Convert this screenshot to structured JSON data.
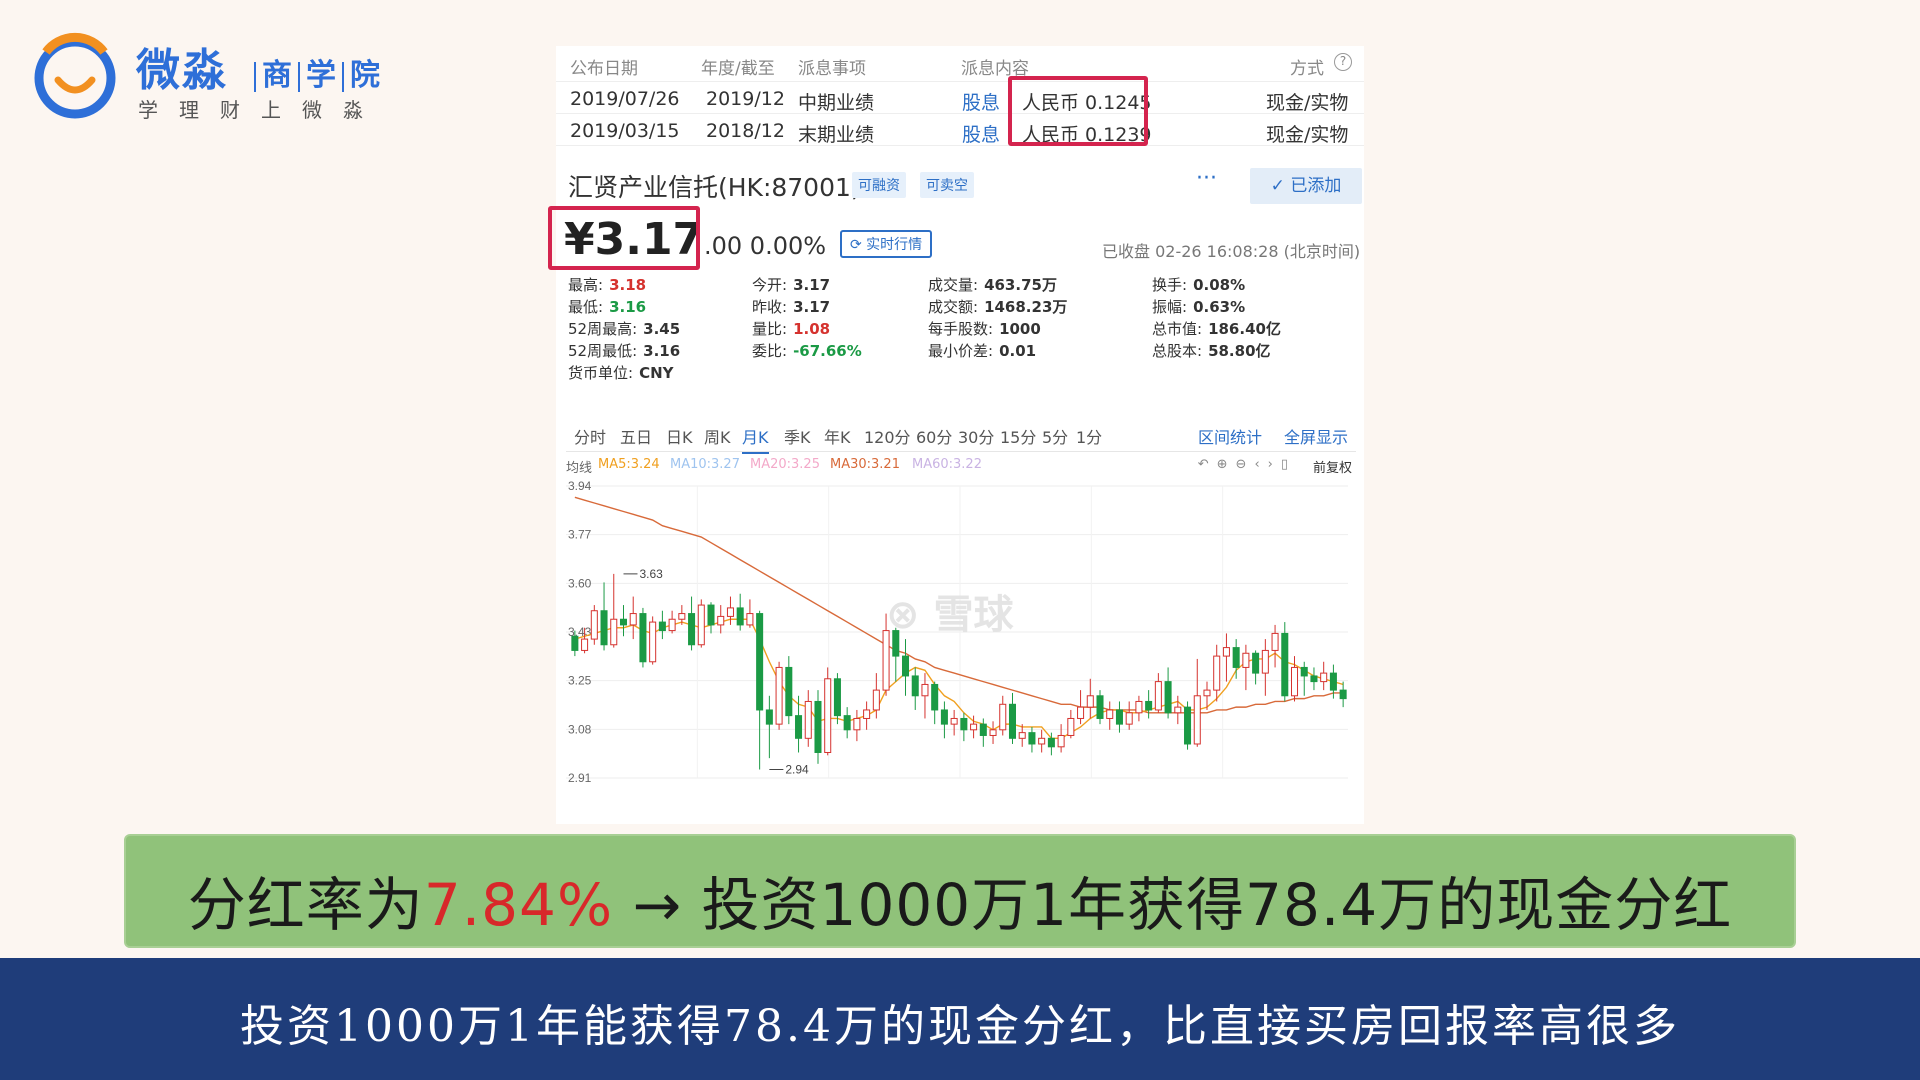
{
  "logo": {
    "title": "微淼",
    "sub1": "商",
    "sub2": "学",
    "sub3": "院",
    "slogan": "学理财上微淼",
    "icon": "smile-circle-logo"
  },
  "dividend_table": {
    "headers": [
      "公布日期",
      "年度/截至",
      "派息事项",
      "派息内容",
      "方式"
    ],
    "help_icon": "question-circle-icon",
    "rows": [
      {
        "date": "2019/07/26",
        "period": "2019/12",
        "type": "中期业绩",
        "kind": "股息",
        "content": "人民币 0.1245",
        "method": "现金/实物"
      },
      {
        "date": "2019/03/15",
        "period": "2018/12",
        "type": "末期业绩",
        "kind": "股息",
        "content": "人民币 0.1239",
        "method": "现金/实物"
      }
    ]
  },
  "stock": {
    "name": "汇贤产业信托(HK:87001)",
    "tag1": "可融资",
    "tag2": "可卖空",
    "more": "···",
    "added": "✓ 已添加",
    "price": "¥3.17",
    "change": ".00 0.00%",
    "realtime": "⟳ 实时行情",
    "closed_info": "已收盘 02-26 16:08:28 (北京时间)"
  },
  "stats": {
    "high_label": "最高:",
    "high": "3.18",
    "low_label": "最低:",
    "low": "3.16",
    "w52h_label": "52周最高:",
    "w52h": "3.45",
    "w52l_label": "52周最低:",
    "w52l": "3.16",
    "cur_label": "货币单位:",
    "cur": "CNY",
    "open_label": "今开:",
    "open": "3.17",
    "prev_label": "昨收:",
    "prev": "3.17",
    "vr_label": "量比:",
    "vr": "1.08",
    "wb_label": "委比:",
    "wb": "-67.66%",
    "vol_label": "成交量:",
    "vol": "463.75万",
    "amt_label": "成交额:",
    "amt": "1468.23万",
    "lot_label": "每手股数:",
    "lot": "1000",
    "tick_label": "最小价差:",
    "tick": "0.01",
    "turn_label": "换手:",
    "turn": "0.08%",
    "amp_label": "振幅:",
    "amp": "0.63%",
    "mcap_label": "总市值:",
    "mcap": "186.40亿",
    "shares_label": "总股本:",
    "shares": "58.80亿"
  },
  "chart_tabs": {
    "tabs": [
      "分时",
      "五日",
      "日K",
      "周K",
      "月K",
      "季K",
      "年K",
      "120分",
      "60分",
      "30分",
      "15分",
      "5分",
      "1分"
    ],
    "active": "月K",
    "range_stats": "区间统计",
    "fullscreen": "全屏显示"
  },
  "ma": {
    "label": "均线",
    "ma5": "MA5:3.24",
    "ma10": "MA10:3.27",
    "ma20": "MA20:3.25",
    "ma30": "MA30:3.21",
    "ma60": "MA60:3.22",
    "adjust": "前复权",
    "colors": {
      "ma5": "#f0a020",
      "ma10": "#9fc4ef",
      "ma20": "#f3a9c9",
      "ma30": "#d86a3a",
      "ma60": "#c9b3e3"
    }
  },
  "chart_data": {
    "type": "candlestick",
    "yticks": [
      "3.94",
      "3.77",
      "3.60",
      "3.43",
      "3.25",
      "3.08",
      "2.91"
    ],
    "ylim": [
      2.91,
      3.94
    ],
    "annotations": [
      {
        "text": "3.63",
        "x": 5,
        "y": 3.63
      },
      {
        "text": "2.94",
        "x": 20,
        "y": 2.94
      }
    ],
    "watermark": "雪球",
    "up_color": "#d5322e",
    "down_color": "#1b9a45",
    "candles": [
      [
        3.41,
        3.36,
        3.43,
        3.34
      ],
      [
        3.36,
        3.4,
        3.44,
        3.35
      ],
      [
        3.4,
        3.5,
        3.52,
        3.38
      ],
      [
        3.5,
        3.38,
        3.6,
        3.36
      ],
      [
        3.38,
        3.47,
        3.63,
        3.37
      ],
      [
        3.47,
        3.45,
        3.52,
        3.41
      ],
      [
        3.45,
        3.49,
        3.55,
        3.4
      ],
      [
        3.49,
        3.32,
        3.51,
        3.3
      ],
      [
        3.32,
        3.46,
        3.48,
        3.31
      ],
      [
        3.46,
        3.43,
        3.5,
        3.4
      ],
      [
        3.43,
        3.47,
        3.5,
        3.42
      ],
      [
        3.47,
        3.49,
        3.52,
        3.45
      ],
      [
        3.49,
        3.38,
        3.55,
        3.36
      ],
      [
        3.38,
        3.52,
        3.54,
        3.37
      ],
      [
        3.52,
        3.45,
        3.53,
        3.42
      ],
      [
        3.45,
        3.48,
        3.52,
        3.42
      ],
      [
        3.48,
        3.51,
        3.55,
        3.45
      ],
      [
        3.51,
        3.45,
        3.56,
        3.43
      ],
      [
        3.45,
        3.49,
        3.54,
        3.44
      ],
      [
        3.49,
        3.15,
        3.5,
        2.94
      ],
      [
        3.15,
        3.1,
        3.2,
        2.98
      ],
      [
        3.1,
        3.3,
        3.32,
        3.08
      ],
      [
        3.3,
        3.13,
        3.34,
        3.1
      ],
      [
        3.13,
        3.05,
        3.2,
        3.0
      ],
      [
        3.05,
        3.18,
        3.22,
        3.02
      ],
      [
        3.18,
        3.0,
        3.22,
        2.96
      ],
      [
        3.0,
        3.26,
        3.3,
        2.99
      ],
      [
        3.26,
        3.13,
        3.28,
        3.1
      ],
      [
        3.13,
        3.08,
        3.16,
        3.05
      ],
      [
        3.08,
        3.12,
        3.15,
        3.04
      ],
      [
        3.12,
        3.15,
        3.18,
        3.08
      ],
      [
        3.15,
        3.22,
        3.28,
        3.12
      ],
      [
        3.22,
        3.43,
        3.49,
        3.2
      ],
      [
        3.43,
        3.34,
        3.44,
        3.25
      ],
      [
        3.34,
        3.27,
        3.4,
        3.2
      ],
      [
        3.27,
        3.2,
        3.3,
        3.15
      ],
      [
        3.2,
        3.24,
        3.28,
        3.12
      ],
      [
        3.24,
        3.15,
        3.25,
        3.1
      ],
      [
        3.15,
        3.1,
        3.18,
        3.05
      ],
      [
        3.1,
        3.12,
        3.15,
        3.06
      ],
      [
        3.12,
        3.08,
        3.14,
        3.04
      ],
      [
        3.08,
        3.1,
        3.13,
        3.05
      ],
      [
        3.1,
        3.06,
        3.12,
        3.02
      ],
      [
        3.06,
        3.08,
        3.11,
        3.03
      ],
      [
        3.08,
        3.17,
        3.2,
        3.06
      ],
      [
        3.17,
        3.05,
        3.21,
        3.03
      ],
      [
        3.05,
        3.07,
        3.1,
        3.02
      ],
      [
        3.07,
        3.03,
        3.09,
        3.0
      ],
      [
        3.03,
        3.05,
        3.08,
        3.0
      ],
      [
        3.05,
        3.02,
        3.07,
        2.99
      ],
      [
        3.02,
        3.06,
        3.1,
        3.0
      ],
      [
        3.06,
        3.12,
        3.15,
        3.05
      ],
      [
        3.12,
        3.16,
        3.22,
        3.1
      ],
      [
        3.16,
        3.2,
        3.26,
        3.12
      ],
      [
        3.2,
        3.12,
        3.22,
        3.1
      ],
      [
        3.12,
        3.15,
        3.18,
        3.08
      ],
      [
        3.15,
        3.1,
        3.18,
        3.07
      ],
      [
        3.1,
        3.14,
        3.18,
        3.08
      ],
      [
        3.14,
        3.18,
        3.2,
        3.11
      ],
      [
        3.18,
        3.15,
        3.22,
        3.12
      ],
      [
        3.15,
        3.25,
        3.28,
        3.14
      ],
      [
        3.25,
        3.14,
        3.3,
        3.12
      ],
      [
        3.14,
        3.16,
        3.2,
        3.1
      ],
      [
        3.16,
        3.03,
        3.18,
        3.01
      ],
      [
        3.03,
        3.2,
        3.33,
        3.02
      ],
      [
        3.2,
        3.22,
        3.25,
        3.15
      ],
      [
        3.22,
        3.34,
        3.38,
        3.18
      ],
      [
        3.34,
        3.37,
        3.42,
        3.25
      ],
      [
        3.37,
        3.3,
        3.4,
        3.26
      ],
      [
        3.3,
        3.35,
        3.38,
        3.22
      ],
      [
        3.35,
        3.28,
        3.36,
        3.24
      ],
      [
        3.28,
        3.36,
        3.4,
        3.2
      ],
      [
        3.36,
        3.42,
        3.45,
        3.3
      ],
      [
        3.42,
        3.2,
        3.46,
        3.18
      ],
      [
        3.2,
        3.3,
        3.34,
        3.18
      ],
      [
        3.3,
        3.27,
        3.32,
        3.2
      ],
      [
        3.27,
        3.25,
        3.3,
        3.22
      ],
      [
        3.25,
        3.28,
        3.32,
        3.22
      ],
      [
        3.28,
        3.22,
        3.31,
        3.19
      ],
      [
        3.22,
        3.19,
        3.25,
        3.16
      ]
    ],
    "ma5": [
      3.4,
      3.41,
      3.42,
      3.43,
      3.44,
      3.44,
      3.45,
      3.43,
      3.42,
      3.44,
      3.45,
      3.46,
      3.45,
      3.44,
      3.45,
      3.46,
      3.47,
      3.47,
      3.47,
      3.4,
      3.32,
      3.25,
      3.2,
      3.17,
      3.16,
      3.11,
      3.12,
      3.12,
      3.11,
      3.12,
      3.13,
      3.15,
      3.22,
      3.25,
      3.28,
      3.3,
      3.29,
      3.24,
      3.2,
      3.18,
      3.14,
      3.11,
      3.1,
      3.08,
      3.1,
      3.1,
      3.09,
      3.09,
      3.09,
      3.05,
      3.05,
      3.07,
      3.09,
      3.12,
      3.14,
      3.15,
      3.15,
      3.14,
      3.14,
      3.15,
      3.16,
      3.17,
      3.18,
      3.15,
      3.15,
      3.16,
      3.19,
      3.23,
      3.29,
      3.32,
      3.33,
      3.33,
      3.35,
      3.32,
      3.31,
      3.29,
      3.27,
      3.26,
      3.25,
      3.24
    ],
    "ma30": [
      3.9,
      3.89,
      3.88,
      3.87,
      3.86,
      3.85,
      3.84,
      3.83,
      3.82,
      3.8,
      3.79,
      3.78,
      3.77,
      3.76,
      3.74,
      3.72,
      3.7,
      3.68,
      3.66,
      3.64,
      3.62,
      3.6,
      3.58,
      3.56,
      3.54,
      3.52,
      3.5,
      3.48,
      3.46,
      3.44,
      3.42,
      3.4,
      3.38,
      3.36,
      3.35,
      3.33,
      3.32,
      3.3,
      3.29,
      3.28,
      3.27,
      3.26,
      3.25,
      3.24,
      3.23,
      3.22,
      3.21,
      3.2,
      3.19,
      3.18,
      3.17,
      3.17,
      3.16,
      3.16,
      3.16,
      3.15,
      3.15,
      3.15,
      3.15,
      3.14,
      3.14,
      3.14,
      3.14,
      3.14,
      3.14,
      3.14,
      3.15,
      3.15,
      3.16,
      3.16,
      3.17,
      3.17,
      3.18,
      3.18,
      3.19,
      3.19,
      3.2,
      3.2,
      3.21,
      3.21
    ]
  },
  "caption": {
    "prefix": "分红率为",
    "highlight": "7.84%",
    "suffix": " → 投资1000万1年获得78.4万的现金分红"
  },
  "subtitle": "投资1000万1年能获得78.4万的现金分红，比直接买房回报率高很多"
}
